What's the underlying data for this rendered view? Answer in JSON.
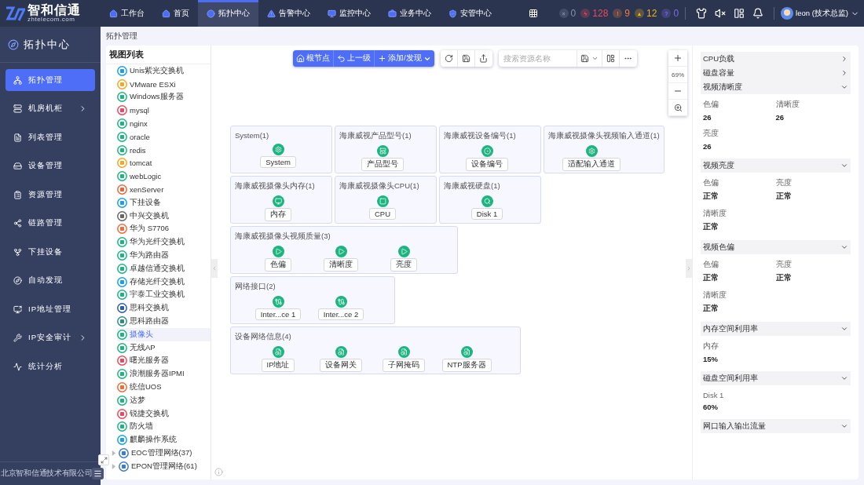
{
  "header": {
    "logo_text": "智和信通",
    "logo_subtext": "zhtelecom.com",
    "nav": [
      {
        "label": "工作台",
        "selected": false
      },
      {
        "label": "首页",
        "selected": false
      },
      {
        "label": "拓扑中心",
        "selected": true
      },
      {
        "label": "告警中心",
        "selected": false
      },
      {
        "label": "监控中心",
        "selected": false
      },
      {
        "label": "业务中心",
        "selected": false
      },
      {
        "label": "安管中心",
        "selected": false
      }
    ],
    "alerts": [
      {
        "symbol": "×",
        "count": "0",
        "color": "#8a90a8"
      },
      {
        "symbol": "ϟ",
        "count": "128",
        "color": "#f0485a"
      },
      {
        "symbol": "!",
        "count": "9",
        "color": "#f07a3c"
      },
      {
        "symbol": "▲",
        "count": "12",
        "color": "#f2b51c"
      },
      {
        "symbol": "?",
        "count": "0",
        "color": "#7c6cf0"
      }
    ],
    "user": "leon (技术总监)"
  },
  "sidebar": {
    "title": "拓扑中心",
    "items": [
      {
        "label": "拓扑管理",
        "selected": true,
        "expandable": false
      },
      {
        "label": "机房机柜",
        "selected": false,
        "expandable": true
      },
      {
        "label": "列表管理",
        "selected": false,
        "expandable": false
      },
      {
        "label": "设备管理",
        "selected": false,
        "expandable": false
      },
      {
        "label": "资源管理",
        "selected": false,
        "expandable": false
      },
      {
        "label": "链路管理",
        "selected": false,
        "expandable": false
      },
      {
        "label": "下挂设备",
        "selected": false,
        "expandable": false
      },
      {
        "label": "自动发现",
        "selected": false,
        "expandable": false
      },
      {
        "label": "IP地址管理",
        "selected": false,
        "expandable": false
      },
      {
        "label": "IP安全审计",
        "selected": false,
        "expandable": true
      },
      {
        "label": "统计分析",
        "selected": false,
        "expandable": false
      }
    ],
    "footer": "北京智和信通技术有限公司"
  },
  "breadcrumb": "拓扑管理",
  "view_list": {
    "title": "视图列表",
    "items": [
      {
        "label": "Unis紫光交换机",
        "selected": false
      },
      {
        "label": "VMware ESXi",
        "selected": false
      },
      {
        "label": "Windows服务器",
        "selected": false
      },
      {
        "label": "mysql",
        "selected": false
      },
      {
        "label": "nginx",
        "selected": false
      },
      {
        "label": "oracle",
        "selected": false
      },
      {
        "label": "redis",
        "selected": false
      },
      {
        "label": "tomcat",
        "selected": false
      },
      {
        "label": "webLogic",
        "selected": false
      },
      {
        "label": "xenServer",
        "selected": false
      },
      {
        "label": "下挂设备",
        "selected": false
      },
      {
        "label": "中兴交换机",
        "selected": false
      },
      {
        "label": "华为 S7706",
        "selected": false
      },
      {
        "label": "华为光纤交换机",
        "selected": false
      },
      {
        "label": "华为路由器",
        "selected": false
      },
      {
        "label": "卓越信通交换机",
        "selected": false
      },
      {
        "label": "存储光纤交换机",
        "selected": false
      },
      {
        "label": "宇泰工业交换机",
        "selected": false
      },
      {
        "label": "思科交换机",
        "selected": false
      },
      {
        "label": "思科路由器",
        "selected": false
      },
      {
        "label": "摄像头",
        "selected": true
      },
      {
        "label": "无线AP",
        "selected": false
      },
      {
        "label": "曙光服务器",
        "selected": false
      },
      {
        "label": "浪潮服务器IPMI",
        "selected": false
      },
      {
        "label": "统信UOS",
        "selected": false
      },
      {
        "label": "达梦",
        "selected": false
      },
      {
        "label": "锐捷交换机",
        "selected": false
      },
      {
        "label": "防火墙",
        "selected": false
      },
      {
        "label": "麒麟操作系统",
        "selected": false
      },
      {
        "label": "EOC管理网络(37)",
        "selected": false,
        "expanded": false
      },
      {
        "label": "EPON管理网络(61)",
        "selected": false,
        "expanded": false
      }
    ]
  },
  "toolbar": {
    "buttons": [
      "根节点",
      "上一级",
      "添加/发现"
    ],
    "search_placeholder": "搜索资源名称",
    "zoom": "69%"
  },
  "topology": {
    "rows": [
      {
        "groups": [
          {
            "title": "System(1)",
            "nodes": [
              "System"
            ]
          },
          {
            "title": "海康威视产品型号(1)",
            "nodes": [
              "产品型号"
            ]
          },
          {
            "title": "海康威视设备编号(1)",
            "nodes": [
              "设备编号"
            ]
          },
          {
            "title": "海康威视摄像头视频输入通道(1)",
            "nodes": [
              "适配输入通道"
            ]
          }
        ]
      },
      {
        "groups": [
          {
            "title": "海康威视摄像头内存(1)",
            "nodes": [
              "内存"
            ]
          },
          {
            "title": "海康威视摄像头CPU(1)",
            "nodes": [
              "CPU"
            ]
          },
          {
            "title": "海康威视硬盘(1)",
            "nodes": [
              "Disk 1"
            ]
          }
        ]
      },
      {
        "groups": [
          {
            "title": "海康威视摄像头视频质量(3)",
            "nodes": [
              "色偏",
              "清晰度",
              "亮度"
            ]
          }
        ]
      },
      {
        "groups": [
          {
            "title": "网络接口(2)",
            "nodes": [
              "Inter...ce 1",
              "Inter...ce 2"
            ]
          }
        ]
      },
      {
        "groups": [
          {
            "title": "设备网络信息(4)",
            "nodes": [
              "IP地址",
              "设备网关",
              "子网掩码",
              "NTP服务器"
            ]
          }
        ]
      }
    ]
  },
  "details": {
    "sections": [
      {
        "title": "CPU负载",
        "expanded": false
      },
      {
        "title": "磁盘容量",
        "expanded": false
      },
      {
        "title": "视频清晰度",
        "expanded": true,
        "fields": [
          {
            "label": "色偏",
            "value": "26"
          },
          {
            "label": "清晰度",
            "value": "26"
          },
          {
            "label": "亮度",
            "value": "26"
          }
        ]
      },
      {
        "title": "视频亮度",
        "expanded": true,
        "fields": [
          {
            "label": "色偏",
            "value": "正常"
          },
          {
            "label": "亮度",
            "value": "正常"
          },
          {
            "label": "清晰度",
            "value": "正常"
          }
        ]
      },
      {
        "title": "视频色偏",
        "expanded": true,
        "fields": [
          {
            "label": "色偏",
            "value": "正常"
          },
          {
            "label": "亮度",
            "value": "正常"
          },
          {
            "label": "清晰度",
            "value": "正常"
          }
        ]
      },
      {
        "title": "内存空间利用率",
        "expanded": true,
        "fields": [
          {
            "label": "内存",
            "value": "15%"
          }
        ]
      },
      {
        "title": "磁盘空间利用率",
        "expanded": true,
        "fields": [
          {
            "label": "Disk 1",
            "value": "60%"
          }
        ]
      },
      {
        "title": "网口输入输出流量",
        "expanded": true
      }
    ]
  }
}
